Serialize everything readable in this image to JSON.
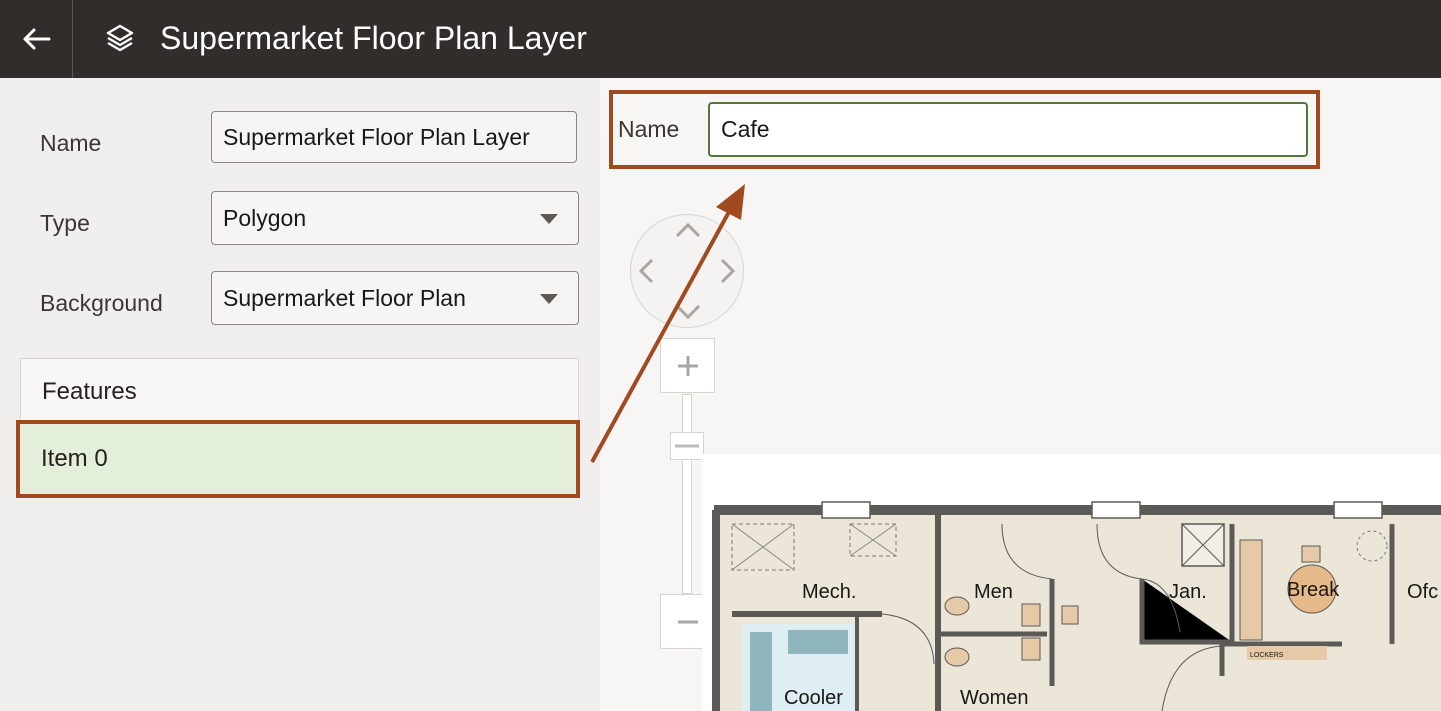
{
  "header": {
    "title": "Supermarket Floor Plan Layer",
    "back_icon": "arrow-left-icon",
    "layers_icon": "layers-icon"
  },
  "form": {
    "name_label": "Name",
    "name_value": "Supermarket Floor Plan Layer",
    "type_label": "Type",
    "type_value": "Polygon",
    "background_label": "Background",
    "background_value": "Supermarket Floor Plan"
  },
  "features": {
    "header": "Features",
    "items": [
      {
        "label": "Item 0"
      }
    ]
  },
  "feature_editor": {
    "name_label": "Name",
    "name_value": "Cafe"
  },
  "map": {
    "controls": {
      "pan_icon": "pan-compass-icon",
      "zoom_in_icon": "plus-icon",
      "zoom_out_icon": "minus-icon"
    },
    "rooms": {
      "mech": "Mech.",
      "men": "Men",
      "jan": "Jan.",
      "break": "Break",
      "ofc": "Ofc",
      "cooler": "Cooler",
      "women": "Women",
      "lockers": "LOCKERS"
    }
  },
  "colors": {
    "header_bg": "#312d2a",
    "highlight": "#a24a1f",
    "selected_row": "#e4efd9",
    "input_border_focus": "#4f7a3a"
  }
}
